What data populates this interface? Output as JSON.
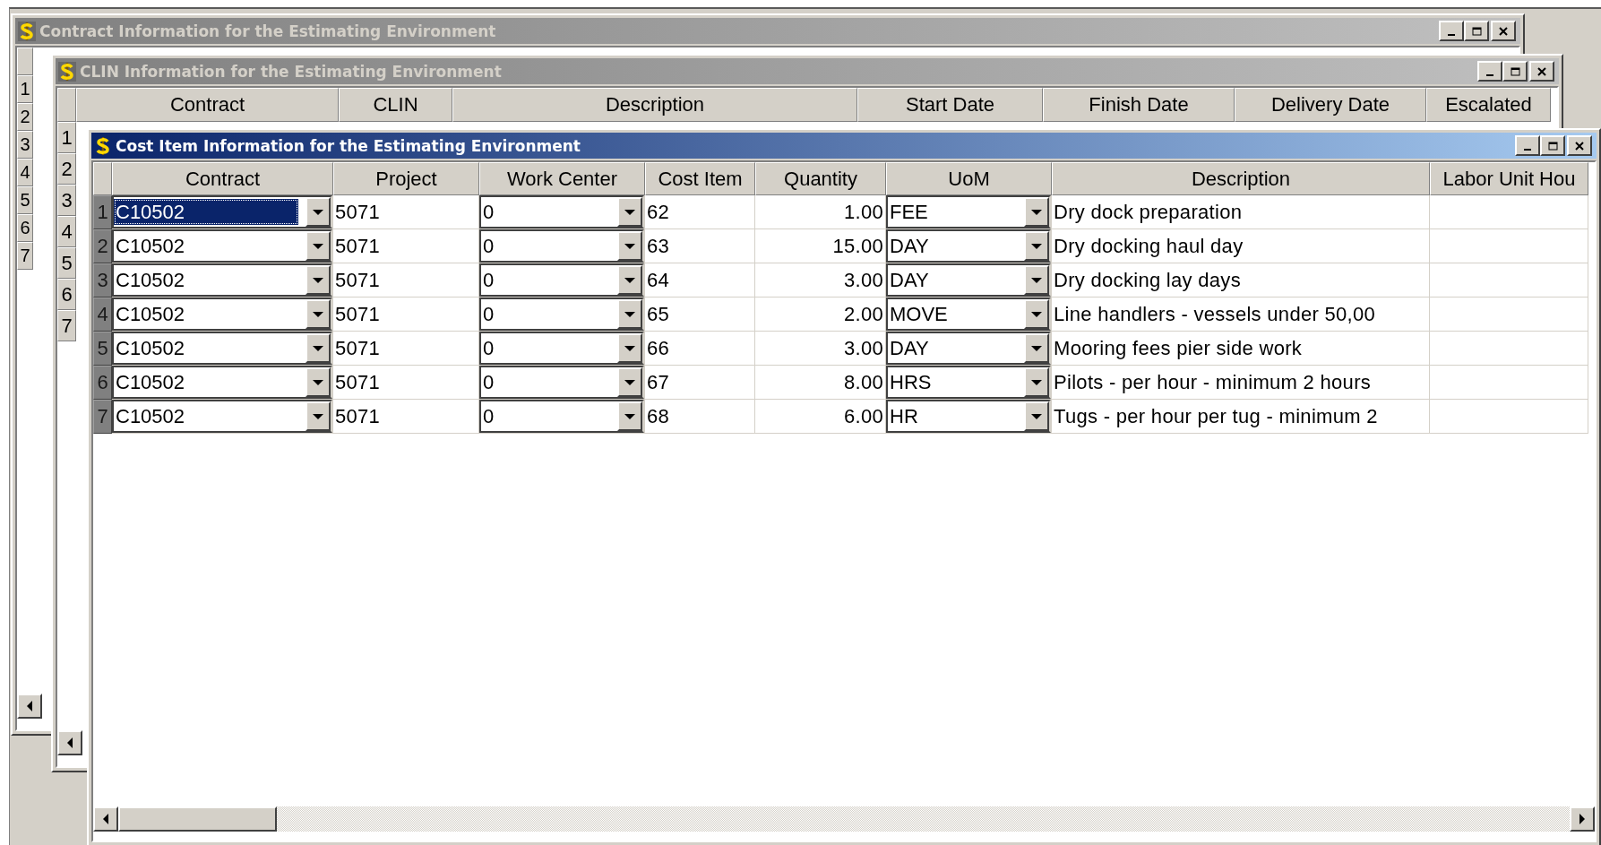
{
  "contract_window": {
    "title": "Contract Information for the Estimating Environment",
    "active": false,
    "row_numbers": [
      "1",
      "2",
      "3",
      "4",
      "5",
      "6",
      "7"
    ]
  },
  "clin_window": {
    "title": "CLIN Information for the Estimating Environment",
    "active": false,
    "columns": [
      "Contract",
      "CLIN",
      "Description",
      "Start Date",
      "Finish Date",
      "Delivery Date",
      "Escalated"
    ],
    "row_numbers": [
      "1",
      "2",
      "3",
      "4",
      "5",
      "6",
      "7"
    ]
  },
  "cost_item_window": {
    "title": "Cost Item Information for the Estimating Environment",
    "active": true,
    "columns": [
      "Contract",
      "Project",
      "Work Center",
      "Cost Item",
      "Quantity",
      "UoM",
      "Description",
      "Labor Unit Hou"
    ],
    "rows": [
      {
        "number": "1",
        "selected": true,
        "cells": [
          {
            "kind": "combo",
            "text": "C10502"
          },
          {
            "kind": "text",
            "text": "5071"
          },
          {
            "kind": "combo",
            "text": "0"
          },
          {
            "kind": "text",
            "text": "62"
          },
          {
            "kind": "number",
            "text": "1.00"
          },
          {
            "kind": "combo",
            "text": "FEE"
          },
          {
            "kind": "text",
            "text": "Dry dock preparation"
          }
        ]
      },
      {
        "number": "2",
        "selected": false,
        "cells": [
          {
            "kind": "combo",
            "text": "C10502"
          },
          {
            "kind": "text",
            "text": "5071"
          },
          {
            "kind": "combo",
            "text": "0"
          },
          {
            "kind": "text",
            "text": "63"
          },
          {
            "kind": "number",
            "text": "15.00"
          },
          {
            "kind": "combo",
            "text": "DAY"
          },
          {
            "kind": "text",
            "text": "Dry docking haul day"
          }
        ]
      },
      {
        "number": "3",
        "selected": false,
        "cells": [
          {
            "kind": "combo",
            "text": "C10502"
          },
          {
            "kind": "text",
            "text": "5071"
          },
          {
            "kind": "combo",
            "text": "0"
          },
          {
            "kind": "text",
            "text": "64"
          },
          {
            "kind": "number",
            "text": "3.00"
          },
          {
            "kind": "combo",
            "text": "DAY"
          },
          {
            "kind": "text",
            "text": "Dry docking lay days"
          }
        ]
      },
      {
        "number": "4",
        "selected": false,
        "cells": [
          {
            "kind": "combo",
            "text": "C10502"
          },
          {
            "kind": "text",
            "text": "5071"
          },
          {
            "kind": "combo",
            "text": "0"
          },
          {
            "kind": "text",
            "text": "65"
          },
          {
            "kind": "number",
            "text": "2.00"
          },
          {
            "kind": "combo",
            "text": "MOVE"
          },
          {
            "kind": "text",
            "text": "Line handlers - vessels under 50,00"
          }
        ]
      },
      {
        "number": "5",
        "selected": false,
        "cells": [
          {
            "kind": "combo",
            "text": "C10502"
          },
          {
            "kind": "text",
            "text": "5071"
          },
          {
            "kind": "combo",
            "text": "0"
          },
          {
            "kind": "text",
            "text": "66"
          },
          {
            "kind": "number",
            "text": "3.00"
          },
          {
            "kind": "combo",
            "text": "DAY"
          },
          {
            "kind": "text",
            "text": "Mooring fees pier side work"
          }
        ]
      },
      {
        "number": "6",
        "selected": false,
        "cells": [
          {
            "kind": "combo",
            "text": "C10502"
          },
          {
            "kind": "text",
            "text": "5071"
          },
          {
            "kind": "combo",
            "text": "0"
          },
          {
            "kind": "text",
            "text": "67"
          },
          {
            "kind": "number",
            "text": "8.00"
          },
          {
            "kind": "combo",
            "text": "HRS"
          },
          {
            "kind": "text",
            "text": "Pilots - per hour - minimum 2 hours"
          }
        ]
      },
      {
        "number": "7",
        "selected": false,
        "cells": [
          {
            "kind": "combo",
            "text": "C10502"
          },
          {
            "kind": "text",
            "text": "5071"
          },
          {
            "kind": "combo",
            "text": "0"
          },
          {
            "kind": "text",
            "text": "68"
          },
          {
            "kind": "number",
            "text": "6.00"
          },
          {
            "kind": "combo",
            "text": "HR"
          },
          {
            "kind": "text",
            "text": "Tugs - per hour per tug - minimum 2"
          }
        ]
      }
    ]
  }
}
